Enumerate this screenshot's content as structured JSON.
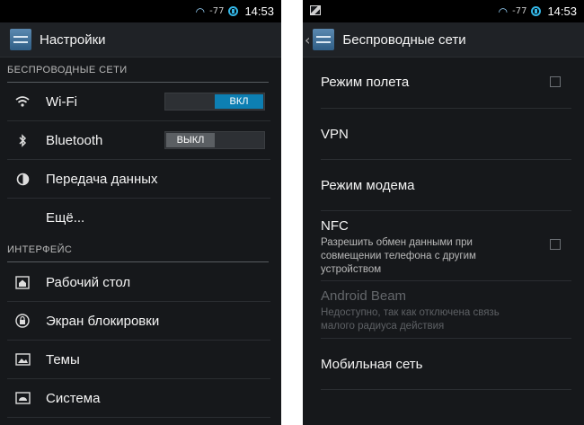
{
  "status": {
    "signal": "-77",
    "time": "14:53"
  },
  "left": {
    "title": "Настройки",
    "sections": {
      "wireless": "БЕСПРОВОДНЫЕ СЕТИ",
      "interface": "ИНТЕРФЕЙС"
    },
    "items": {
      "wifi": "Wi-Fi",
      "bluetooth": "Bluetooth",
      "data": "Передача данных",
      "more": "Ещё...",
      "desktop": "Рабочий стол",
      "lock": "Экран блокировки",
      "themes": "Темы",
      "system": "Система"
    },
    "toggles": {
      "wifi": "ВКЛ",
      "bluetooth": "ВЫКЛ"
    }
  },
  "right": {
    "title": "Беспроводные сети",
    "items": {
      "airplane": "Режим полета",
      "vpn": "VPN",
      "tether": "Режим модема",
      "nfc": "NFC",
      "nfc_desc": "Разрешить обмен данными при совмещении телефона с другим устройством",
      "beam": "Android Beam",
      "beam_desc": "Недоступно, так как отключена связь малого радиуса действия",
      "mobile": "Мобильная сеть"
    }
  },
  "icons": [
    "wifi-icon",
    "bluetooth-icon",
    "data-usage-icon",
    "home-icon",
    "lock-icon",
    "image-icon",
    "android-icon",
    "battery-icon"
  ]
}
